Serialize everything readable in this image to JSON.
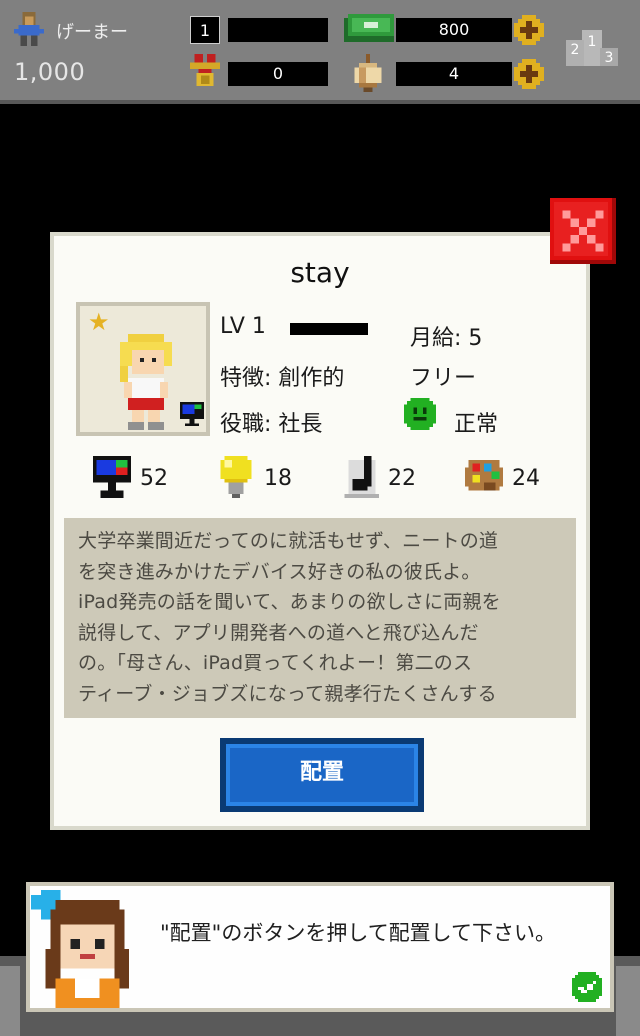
{
  "header": {
    "player_name": "げーまー",
    "money": "1,000",
    "level": "1",
    "medals": "0",
    "cash": "800",
    "onions": "4",
    "icons": [
      "player-icon",
      "medal-icon",
      "cash-icon",
      "onion-icon",
      "plus-icon",
      "ranking-icon"
    ]
  },
  "dialog": {
    "character_name": "stay",
    "level_label": "LV 1",
    "salary": "月給: 5",
    "trait": "特徴: 創作的",
    "contract": "フリー",
    "role": "役職: 社長",
    "status": "正常",
    "stats": [
      {
        "icon": "programming-icon",
        "value": "52"
      },
      {
        "icon": "idea-bulb-icon",
        "value": "18"
      },
      {
        "icon": "music-note-icon",
        "value": "22"
      },
      {
        "icon": "art-palette-icon",
        "value": "24"
      }
    ],
    "description_lines": [
      "大学卒業間近だってのに就活もせず、ニートの道",
      "を突き進みかけたデバイス好きの私の彼氏よ。",
      "iPad発売の話を聞いて、あまりの欲しさに両親を",
      "説得して、アプリ開発者への道へと飛び込んだ",
      "の。「母さん、iPad買ってくれよー！第二のス",
      "ティーブ・ジョブズになって親孝行たくさんする"
    ],
    "place_button": "配置"
  },
  "message": {
    "text": "\"配置\"のボタンを押して配置して下さい。"
  },
  "colors": {
    "topbar": "#808080",
    "dialog_bg": "#fbfbf6",
    "desc_bg": "#cdc9b8",
    "button_blue": "#1a66c6",
    "close_red": "#e01010"
  }
}
